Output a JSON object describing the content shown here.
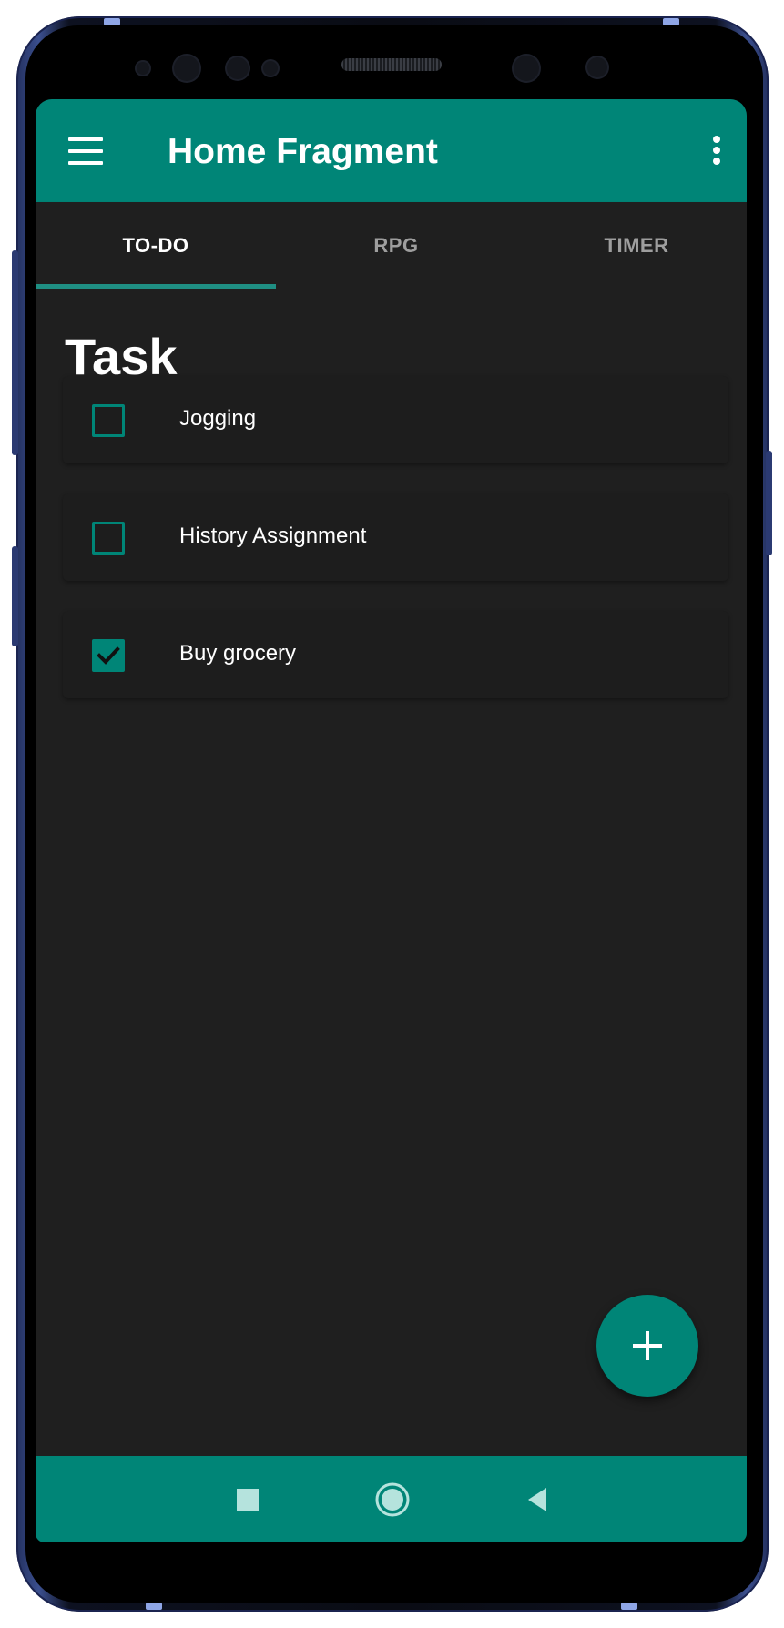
{
  "app_bar": {
    "title": "Home Fragment",
    "menu_icon": "hamburger-icon",
    "overflow_icon": "more-vert-icon",
    "color": "#008577"
  },
  "tabs": [
    {
      "label": "TO-DO",
      "active": true
    },
    {
      "label": "RPG",
      "active": false
    },
    {
      "label": "TIMER",
      "active": false
    }
  ],
  "main": {
    "heading": "Task",
    "tasks": [
      {
        "label": "Jogging",
        "checked": false
      },
      {
        "label": "History Assignment",
        "checked": false
      },
      {
        "label": "Buy grocery",
        "checked": true
      }
    ]
  },
  "fab": {
    "icon": "plus-icon"
  },
  "nav_bar": {
    "buttons": [
      "recents-square-icon",
      "home-circle-icon",
      "back-triangle-icon"
    ]
  },
  "colors": {
    "accent": "#008577",
    "background": "#1f1f1f",
    "text_primary": "#ffffff",
    "text_inactive_tab": "#9e9e9e"
  }
}
